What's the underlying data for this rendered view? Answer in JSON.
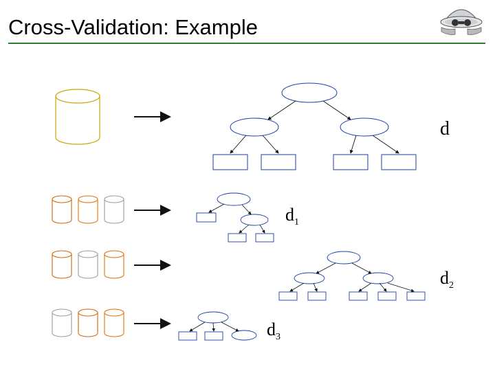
{
  "header": {
    "title": "Cross-Validation: Example"
  },
  "labels": {
    "d": "d",
    "d1": {
      "base": "d",
      "sub": "1"
    },
    "d2": {
      "base": "d",
      "sub": "2"
    },
    "d3": {
      "base": "d",
      "sub": "3"
    }
  },
  "colors": {
    "yellow": "#c9a600",
    "green": "#cc6600",
    "orange": "#e07000",
    "grey": "#9a9a9a",
    "tree_blue": "#1b3fa6",
    "rule": "#2e7d32",
    "arrow": "#111111"
  },
  "icons": {
    "helmet": "hardhat-icon"
  }
}
